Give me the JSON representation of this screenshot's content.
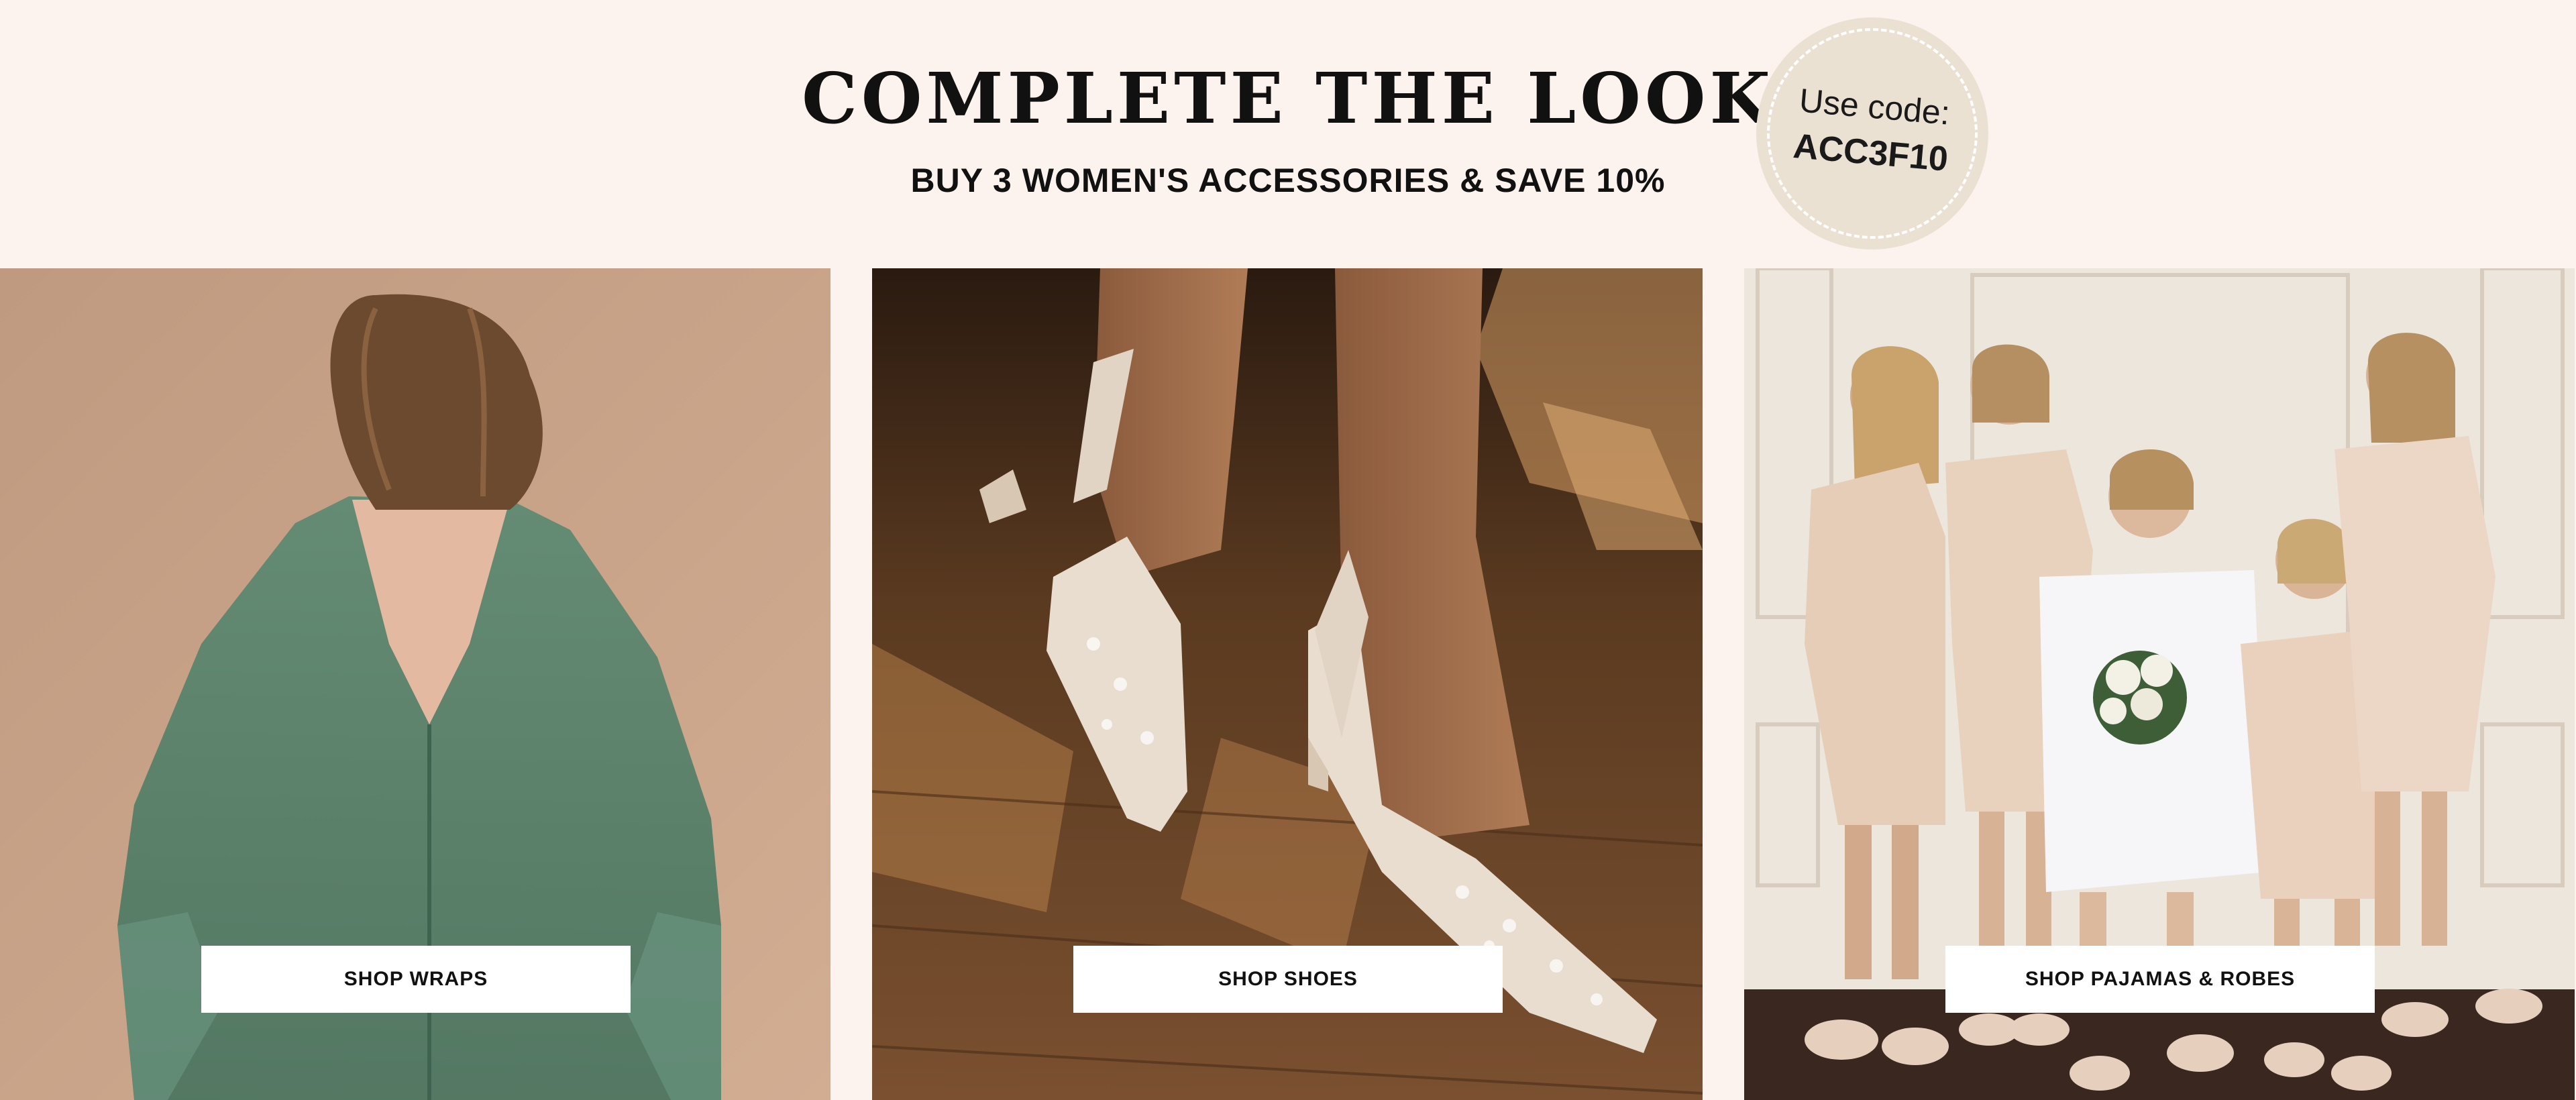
{
  "header": {
    "title": "COMPLETE THE LOOK",
    "subtitle": "BUY 3 WOMEN'S ACCESSORIES & SAVE 10%"
  },
  "promo_badge": {
    "line1": "Use code:",
    "code": "ACC3F10"
  },
  "tiles": [
    {
      "button_label": "SHOP WRAPS",
      "image": "woman-back-green-chiffon-wrap"
    },
    {
      "button_label": "SHOP SHOES",
      "image": "embellished-slingback-heels"
    },
    {
      "button_label": "SHOP PAJAMAS & ROBES",
      "image": "bride-and-bridesmaids-in-robes"
    }
  ],
  "colors": {
    "background": "#fdf3ee",
    "badge": "#ebe1d3",
    "text": "#111111",
    "button": "#ffffff"
  }
}
